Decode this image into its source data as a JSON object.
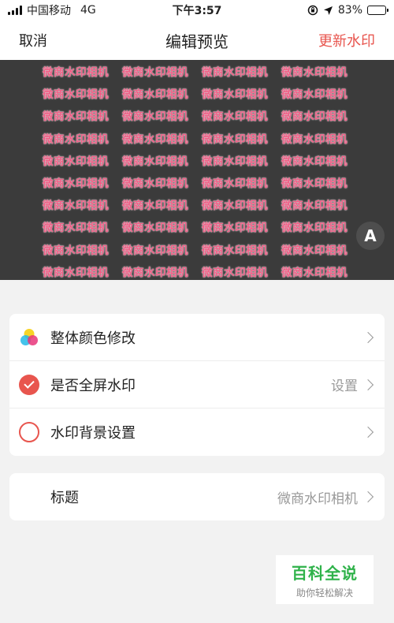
{
  "status": {
    "carrier": "中国移动",
    "network": "4G",
    "time": "下午3:57",
    "battery": "83%",
    "battery_level": 0.83
  },
  "nav": {
    "cancel": "取消",
    "title": "编辑预览",
    "update": "更新水印"
  },
  "preview": {
    "watermark_text": "微商水印相机",
    "font_button": "A",
    "watermark_color": "#ee5f86"
  },
  "settings": {
    "items": [
      {
        "label": "整体颜色修改",
        "icon": "color-wheel-icon",
        "value": ""
      },
      {
        "label": "是否全屏水印",
        "icon": "checked-circle-icon",
        "value": "设置"
      },
      {
        "label": "水印背景设置",
        "icon": "unchecked-circle-icon",
        "value": ""
      }
    ]
  },
  "title_setting": {
    "label": "标题",
    "value": "微商水印相机"
  },
  "badge": {
    "title": "百科全说",
    "subtitle": "助你轻松解决"
  },
  "colors": {
    "accent": "#e8554e",
    "brand_green": "#2fb24a"
  }
}
